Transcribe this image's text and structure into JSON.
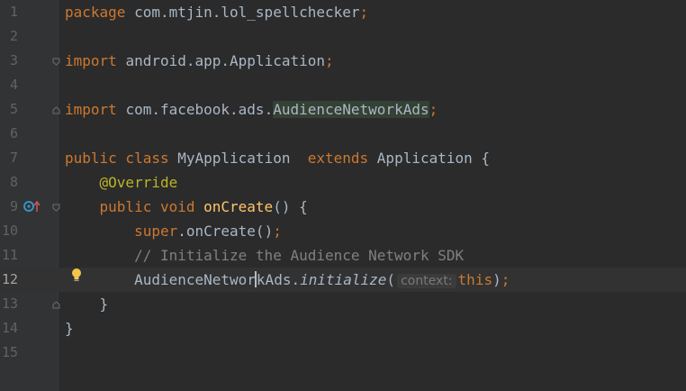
{
  "editor": {
    "lines": [
      {
        "num": "1",
        "tokens": [
          {
            "t": "package ",
            "c": "kw"
          },
          {
            "t": "com.mtjin.lol_spellchecker",
            "c": ""
          },
          {
            "t": ";",
            "c": "kw"
          }
        ]
      },
      {
        "num": "2",
        "tokens": []
      },
      {
        "num": "3",
        "tokens": [
          {
            "t": "import ",
            "c": "kw"
          },
          {
            "t": "android.app.Application",
            "c": ""
          },
          {
            "t": ";",
            "c": "kw"
          }
        ]
      },
      {
        "num": "4",
        "tokens": []
      },
      {
        "num": "5",
        "tokens": [
          {
            "t": "import ",
            "c": "kw"
          },
          {
            "t": "com.facebook.ads.",
            "c": ""
          },
          {
            "t": "AudienceNetworkAds",
            "c": "hl"
          },
          {
            "t": ";",
            "c": "kw"
          }
        ]
      },
      {
        "num": "6",
        "tokens": []
      },
      {
        "num": "7",
        "tokens": [
          {
            "t": "public class ",
            "c": "kw"
          },
          {
            "t": "MyApplication  ",
            "c": ""
          },
          {
            "t": "extends ",
            "c": "kw"
          },
          {
            "t": "Application {",
            "c": ""
          }
        ]
      },
      {
        "num": "8",
        "tokens": [
          {
            "t": "    ",
            "c": ""
          },
          {
            "t": "@Override",
            "c": "ann"
          }
        ]
      },
      {
        "num": "9",
        "tokens": [
          {
            "t": "    ",
            "c": ""
          },
          {
            "t": "public void ",
            "c": "kw"
          },
          {
            "t": "onCreate",
            "c": "fn"
          },
          {
            "t": "() {",
            "c": ""
          }
        ]
      },
      {
        "num": "10",
        "tokens": [
          {
            "t": "        ",
            "c": ""
          },
          {
            "t": "super",
            "c": "kw"
          },
          {
            "t": ".onCreate()",
            "c": ""
          },
          {
            "t": ";",
            "c": "kw"
          }
        ]
      },
      {
        "num": "11",
        "tokens": [
          {
            "t": "        ",
            "c": ""
          },
          {
            "t": "// Initialize the Audience Network SDK",
            "c": "cm"
          }
        ]
      },
      {
        "num": "12",
        "tokens": [
          {
            "t": "        ",
            "c": ""
          },
          {
            "t": "AudienceNetwor",
            "c": ""
          },
          {
            "t": "",
            "c": "caret"
          },
          {
            "t": "kAds.",
            "c": ""
          },
          {
            "t": "initialize",
            "c": "it"
          },
          {
            "t": "(",
            "c": ""
          },
          {
            "t": "context:",
            "c": "hint"
          },
          {
            "t": "this",
            "c": "kw"
          },
          {
            "t": ")",
            "c": ""
          },
          {
            "t": ";",
            "c": "kw"
          }
        ]
      },
      {
        "num": "13",
        "tokens": [
          {
            "t": "    }",
            "c": ""
          }
        ]
      },
      {
        "num": "14",
        "tokens": [
          {
            "t": "}",
            "c": ""
          }
        ]
      },
      {
        "num": "15",
        "tokens": []
      }
    ],
    "current_line": "12"
  }
}
